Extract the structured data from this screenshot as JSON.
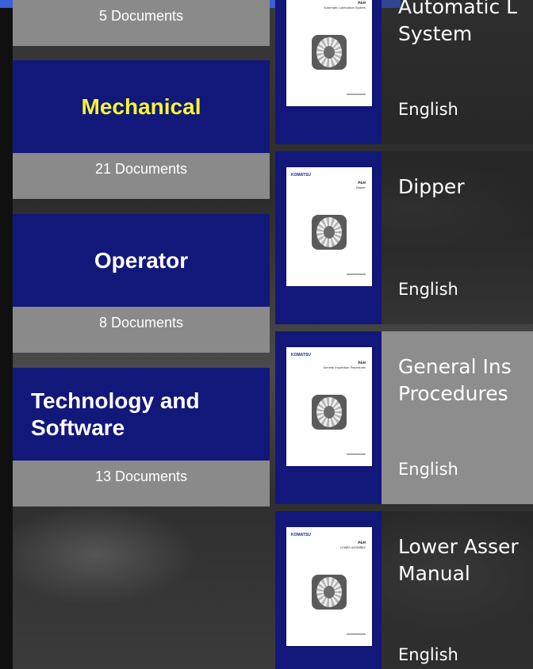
{
  "categories": [
    {
      "title": "",
      "count": "5 Documents"
    },
    {
      "title": "Mechanical",
      "count": "21 Documents"
    },
    {
      "title": "Operator",
      "count": "8 Documents"
    },
    {
      "title": "Technology and Software",
      "count": "13 Documents"
    }
  ],
  "documents": [
    {
      "title_line1": "Automatic L",
      "title_line2": "System",
      "language": "English",
      "cover_subtitle": "Automatic Lubrication System"
    },
    {
      "title_line1": "Dipper",
      "title_line2": "",
      "language": "English",
      "cover_subtitle": "Dipper"
    },
    {
      "title_line1": "General Ins",
      "title_line2": "Procedures",
      "language": "English",
      "cover_subtitle": "General Inspection Procedures"
    },
    {
      "title_line1": "Lower Asser",
      "title_line2": "Manual",
      "language": "English",
      "cover_subtitle": "LOWER ASSEMBLY"
    }
  ],
  "cover": {
    "brand": "KOMATSU",
    "badge": "P&H"
  },
  "colors": {
    "tile_blue": "#12177a",
    "count_gray": "#8a8a8a",
    "active_title": "#f5f532",
    "top_bar": "#3a5fd6"
  }
}
